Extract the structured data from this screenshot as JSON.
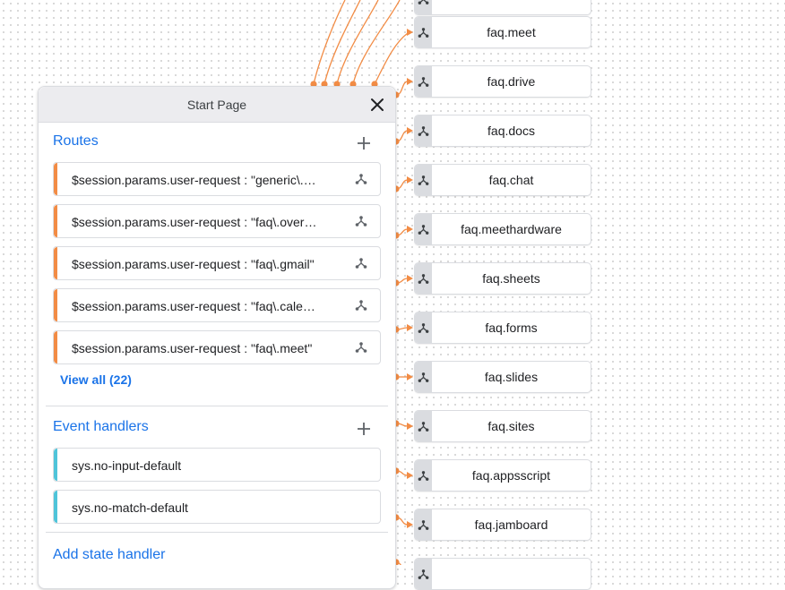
{
  "panel": {
    "title": "Start Page",
    "routes": {
      "title": "Routes",
      "items": [
        {
          "label": "$session.params.user-request : \"generic\\.s…"
        },
        {
          "label": "$session.params.user-request : \"faq\\.overvi…"
        },
        {
          "label": "$session.params.user-request : \"faq\\.gmail\""
        },
        {
          "label": "$session.params.user-request : \"faq\\.calend…"
        },
        {
          "label": "$session.params.user-request : \"faq\\.meet\""
        }
      ],
      "view_all": "View all (22)"
    },
    "event_handlers": {
      "title": "Event handlers",
      "items": [
        {
          "label": "sys.no-input-default"
        },
        {
          "label": "sys.no-match-default"
        }
      ]
    },
    "add_state_handler": "Add state handler"
  },
  "pages": [
    {
      "label": "faq.meet"
    },
    {
      "label": "faq.drive"
    },
    {
      "label": "faq.docs"
    },
    {
      "label": "faq.chat"
    },
    {
      "label": "faq.meethardware"
    },
    {
      "label": "faq.sheets"
    },
    {
      "label": "faq.forms"
    },
    {
      "label": "faq.slides"
    },
    {
      "label": "faq.sites"
    },
    {
      "label": "faq.appsscript"
    },
    {
      "label": "faq.jamboard"
    }
  ],
  "colors": {
    "route_accent": "#f28c45",
    "event_accent": "#4fc4d9",
    "edge": "#f28c45",
    "link": "#1a73e8"
  },
  "icons": {
    "close": "close-icon",
    "add": "add-icon",
    "route_target": "flow-icon",
    "page": "flow-icon"
  }
}
